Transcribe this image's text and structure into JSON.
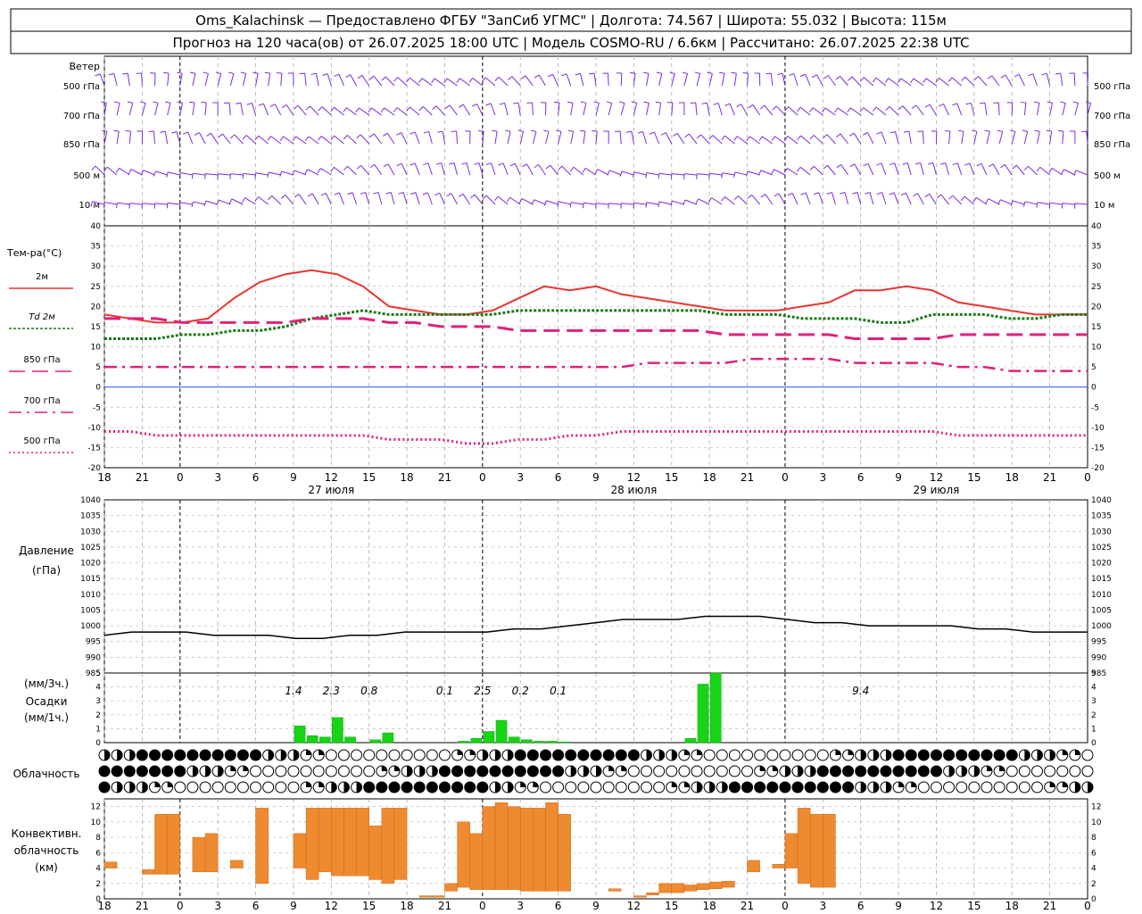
{
  "header": {
    "line1": "Oms_Kalachinsk — Предоставлено ФГБУ \"ЗапСиб УГМС\" | Долгота: 74.567 | Широта: 55.032 | Высота: 115м",
    "line2": "Прогноз на 120 часа(ов) от 26.07.2025 18:00 UTC  | Модель COSMO-RU / 6.6км | Рассчитано: 26.07.2025 22:38 UTC"
  },
  "wind": {
    "title": "Ветер",
    "levels": [
      "500 гПа",
      "700 гПа",
      "850 гПа",
      "500 м",
      "10 м"
    ]
  },
  "legend": {
    "temp_title": "Тем-ра(°C)",
    "items": [
      "2м",
      "Td 2м",
      "850 гПа",
      "700 гПа",
      "500 гПа"
    ]
  },
  "labels": {
    "pressure": [
      "Давление",
      "(гПа)"
    ],
    "precip": [
      "(мм/3ч.)",
      "Осадки",
      "(мм/1ч.)"
    ],
    "cloud": "Облачность",
    "conv": [
      "Конвективн.",
      "облачность",
      "(км)"
    ]
  },
  "colors": {
    "t2m": "#e8352f",
    "td2m": "#1a7a1a",
    "t850": "#e0207a",
    "wind": "#7a2cd8",
    "precip": "#17d417",
    "conv": "#ee8a30"
  },
  "chart_data": [
    {
      "type": "line",
      "name": "temperature",
      "x_hours": [
        0,
        3,
        6,
        9,
        12,
        15,
        18,
        21,
        24,
        27,
        30,
        33,
        36,
        39,
        42,
        45,
        48,
        51,
        54,
        57,
        60,
        63,
        66,
        69,
        72,
        75,
        78,
        81,
        84,
        87,
        90,
        93,
        96,
        99,
        102,
        105,
        108,
        111,
        114,
        117,
        120,
        123,
        126
      ],
      "ylim": [
        -20,
        40
      ],
      "yticks": [
        -20,
        -15,
        -10,
        -5,
        0,
        5,
        10,
        15,
        20,
        25,
        30,
        35,
        40
      ],
      "x_tick_labels": [
        "18",
        "21",
        "0",
        "3",
        "6",
        "9",
        "12",
        "15",
        "18",
        "21",
        "0",
        "3",
        "6",
        "9",
        "12",
        "15",
        "18",
        "21",
        "0",
        "3",
        "6",
        "9",
        "12",
        "15",
        "18",
        "21",
        "0"
      ],
      "date_labels": [
        "27 июля",
        "28 июля",
        "29 июля"
      ],
      "series": [
        {
          "name": "2м",
          "values": [
            18,
            17,
            16,
            16,
            17,
            22,
            26,
            28,
            29,
            28,
            25,
            20,
            19,
            18,
            18,
            19,
            22,
            25,
            24,
            25,
            23,
            22,
            21,
            20,
            19,
            19,
            19,
            20,
            21,
            24,
            24,
            25,
            24,
            21,
            20,
            19,
            18,
            18,
            18
          ]
        },
        {
          "name": "Td 2м",
          "values": [
            12,
            12,
            12,
            13,
            13,
            14,
            14,
            15,
            17,
            18,
            19,
            18,
            18,
            18,
            18,
            18,
            19,
            19,
            19,
            19,
            19,
            19,
            19,
            19,
            18,
            18,
            18,
            17,
            17,
            17,
            16,
            16,
            18,
            18,
            18,
            17,
            17,
            18,
            18
          ]
        },
        {
          "name": "850 гПа",
          "values": [
            17,
            17,
            17,
            16,
            16,
            16,
            16,
            16,
            17,
            17,
            17,
            16,
            16,
            15,
            15,
            15,
            14,
            14,
            14,
            14,
            14,
            14,
            14,
            14,
            13,
            13,
            13,
            13,
            13,
            12,
            12,
            12,
            12,
            13,
            13,
            13,
            13,
            13,
            13
          ]
        },
        {
          "name": "700 гПа",
          "values": [
            5,
            5,
            5,
            5,
            5,
            5,
            5,
            5,
            5,
            5,
            5,
            5,
            5,
            5,
            5,
            5,
            5,
            5,
            5,
            5,
            5,
            6,
            6,
            6,
            6,
            7,
            7,
            7,
            7,
            6,
            6,
            6,
            6,
            5,
            5,
            4,
            4,
            4,
            4
          ]
        },
        {
          "name": "500 гПа",
          "values": [
            -11,
            -11,
            -12,
            -12,
            -12,
            -12,
            -12,
            -12,
            -12,
            -12,
            -12,
            -13,
            -13,
            -13,
            -14,
            -14,
            -13,
            -13,
            -12,
            -12,
            -11,
            -11,
            -11,
            -11,
            -11,
            -11,
            -11,
            -11,
            -11,
            -11,
            -11,
            -11,
            -11,
            -12,
            -12,
            -12,
            -12,
            -12,
            -12
          ]
        }
      ]
    },
    {
      "type": "line",
      "name": "pressure",
      "ylim": [
        985,
        1040
      ],
      "yticks": [
        985,
        990,
        995,
        1000,
        1005,
        1010,
        1015,
        1020,
        1025,
        1030,
        1035,
        1040
      ],
      "series": [
        {
          "name": "Давление",
          "values": [
            997,
            998,
            998,
            998,
            997,
            997,
            997,
            996,
            996,
            997,
            997,
            998,
            998,
            998,
            998,
            999,
            999,
            1000,
            1001,
            1002,
            1002,
            1002,
            1003,
            1003,
            1003,
            1002,
            1001,
            1001,
            1000,
            1000,
            1000,
            1000,
            999,
            999,
            998,
            998,
            998
          ]
        }
      ]
    },
    {
      "type": "bar",
      "name": "precipitation",
      "ylim": [
        0,
        5
      ],
      "yticks": [
        0,
        1,
        2,
        3,
        4,
        5
      ],
      "labels_3h": [
        {
          "hour": 15,
          "text": "1.4"
        },
        {
          "hour": 18,
          "text": "2.3"
        },
        {
          "hour": 21,
          "text": "0.8"
        },
        {
          "hour": 27,
          "text": "0.1"
        },
        {
          "hour": 30,
          "text": "2.5"
        },
        {
          "hour": 33,
          "text": "0.2"
        },
        {
          "hour": 36,
          "text": "0.1"
        },
        {
          "hour": 60,
          "text": "9.4"
        }
      ],
      "bars_1h": [
        {
          "hour": 15.5,
          "v": 1.2
        },
        {
          "hour": 16.5,
          "v": 0.5
        },
        {
          "hour": 17.5,
          "v": 0.4
        },
        {
          "hour": 18.5,
          "v": 1.8
        },
        {
          "hour": 19.5,
          "v": 0.4
        },
        {
          "hour": 21.5,
          "v": 0.2
        },
        {
          "hour": 22.5,
          "v": 0.7
        },
        {
          "hour": 28.5,
          "v": 0.1
        },
        {
          "hour": 29.5,
          "v": 0.3
        },
        {
          "hour": 30.5,
          "v": 0.8
        },
        {
          "hour": 31.5,
          "v": 1.6
        },
        {
          "hour": 32.5,
          "v": 0.4
        },
        {
          "hour": 33.5,
          "v": 0.2
        },
        {
          "hour": 34.5,
          "v": 0.1
        },
        {
          "hour": 35.5,
          "v": 0.1
        },
        {
          "hour": 36.5,
          "v": 0.05
        },
        {
          "hour": 46.5,
          "v": 0.3
        },
        {
          "hour": 47.5,
          "v": 4.2
        },
        {
          "hour": 48.5,
          "v": 5.0
        }
      ]
    },
    {
      "type": "bar",
      "name": "convective_cloud",
      "ylim": [
        0,
        13
      ],
      "yticks": [
        0,
        2,
        4,
        6,
        8,
        10,
        12
      ],
      "bars": [
        {
          "hour": 0.5,
          "b": 4.0,
          "t": 4.8
        },
        {
          "hour": 3.5,
          "b": 3.2,
          "t": 3.8
        },
        {
          "hour": 4.5,
          "b": 3.2,
          "t": 11
        },
        {
          "hour": 5.5,
          "b": 3.2,
          "t": 11
        },
        {
          "hour": 7.5,
          "b": 3.5,
          "t": 8
        },
        {
          "hour": 8.5,
          "b": 3.5,
          "t": 8.5
        },
        {
          "hour": 10.5,
          "b": 4.0,
          "t": 5.0
        },
        {
          "hour": 12.5,
          "b": 2.0,
          "t": 11.8
        },
        {
          "hour": 15.5,
          "b": 4.0,
          "t": 8.5
        },
        {
          "hour": 16.5,
          "b": 2.5,
          "t": 11.8
        },
        {
          "hour": 17.5,
          "b": 3.5,
          "t": 11.8
        },
        {
          "hour": 18.5,
          "b": 3.0,
          "t": 11.8
        },
        {
          "hour": 19.5,
          "b": 3.0,
          "t": 11.8
        },
        {
          "hour": 20.5,
          "b": 3.0,
          "t": 11.8
        },
        {
          "hour": 21.5,
          "b": 2.5,
          "t": 9.5
        },
        {
          "hour": 22.5,
          "b": 2.0,
          "t": 11.8
        },
        {
          "hour": 23.5,
          "b": 2.5,
          "t": 11.8
        },
        {
          "hour": 25.5,
          "b": 0.2,
          "t": 0.4
        },
        {
          "hour": 26.5,
          "b": 0.2,
          "t": 0.4
        },
        {
          "hour": 27.5,
          "b": 1.0,
          "t": 2.0
        },
        {
          "hour": 28.5,
          "b": 1.5,
          "t": 10
        },
        {
          "hour": 29.5,
          "b": 1.2,
          "t": 8.5
        },
        {
          "hour": 30.5,
          "b": 1.2,
          "t": 12
        },
        {
          "hour": 31.5,
          "b": 1.2,
          "t": 12.5
        },
        {
          "hour": 32.5,
          "b": 1.2,
          "t": 12
        },
        {
          "hour": 33.5,
          "b": 1.0,
          "t": 11.8
        },
        {
          "hour": 34.5,
          "b": 1.0,
          "t": 11.8
        },
        {
          "hour": 35.5,
          "b": 1.0,
          "t": 12.5
        },
        {
          "hour": 36.5,
          "b": 1.0,
          "t": 11
        },
        {
          "hour": 40.5,
          "b": 1.0,
          "t": 1.3
        },
        {
          "hour": 42.5,
          "b": 0.2,
          "t": 0.4
        },
        {
          "hour": 43.5,
          "b": 0.5,
          "t": 0.8
        },
        {
          "hour": 44.5,
          "b": 0.8,
          "t": 2.0
        },
        {
          "hour": 45.5,
          "b": 0.8,
          "t": 2.0
        },
        {
          "hour": 46.5,
          "b": 1.0,
          "t": 1.8
        },
        {
          "hour": 47.5,
          "b": 1.2,
          "t": 2.0
        },
        {
          "hour": 48.5,
          "b": 1.3,
          "t": 2.2
        },
        {
          "hour": 49.5,
          "b": 1.5,
          "t": 2.3
        },
        {
          "hour": 51.5,
          "b": 3.5,
          "t": 5.0
        },
        {
          "hour": 53.5,
          "b": 4.0,
          "t": 4.5
        },
        {
          "hour": 54.5,
          "b": 4.0,
          "t": 8.5
        },
        {
          "hour": 55.5,
          "b": 2.0,
          "t": 11.8
        },
        {
          "hour": 56.5,
          "b": 1.5,
          "t": 11
        },
        {
          "hour": 57.5,
          "b": 1.5,
          "t": 11
        }
      ]
    }
  ]
}
